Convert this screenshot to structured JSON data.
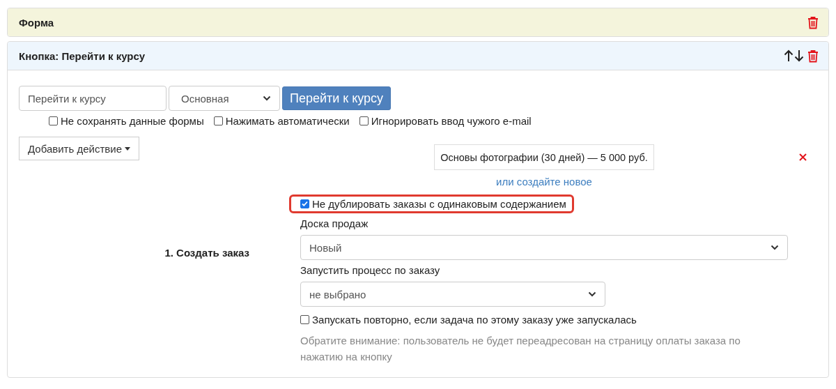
{
  "form_panel": {
    "title": "Форма"
  },
  "button_panel": {
    "title": "Кнопка: Перейти к курсу",
    "text_field": {
      "value": "Перейти к курсу"
    },
    "style_select": {
      "value": "Основная"
    },
    "preview_button": {
      "label": "Перейти к курсу"
    },
    "options": [
      {
        "label": "Не сохранять данные формы",
        "checked": false
      },
      {
        "label": "Нажимать автоматически",
        "checked": false
      },
      {
        "label": "Игнорировать ввод чужого e-mail",
        "checked": false
      }
    ],
    "add_action_button": {
      "label": "Добавить действие"
    },
    "actions": [
      {
        "title": "1. Создать заказ",
        "product": {
          "value": "Основы фотографии (30 дней) — 5 000 руб."
        },
        "create_link": "или создайте новое",
        "no_duplicate": {
          "label": "Не дублировать заказы с одинаковым содержанием",
          "checked": true,
          "highlighted": true
        },
        "fields": [
          {
            "kind": "select",
            "label": "Доска продаж",
            "value": "Новый",
            "wide": true
          },
          {
            "kind": "select",
            "label": "Запустить процесс по заказу",
            "value": "не выбрано",
            "wide": false
          },
          {
            "kind": "checkbox",
            "label": "Запускать повторно, если задача по этому заказу уже запускалась",
            "checked": false
          },
          {
            "kind": "note",
            "text": "Обратите внимание: пользователь не будет переадресован на страницу оплаты заказа по нажатию на кнопку"
          }
        ]
      }
    ]
  }
}
